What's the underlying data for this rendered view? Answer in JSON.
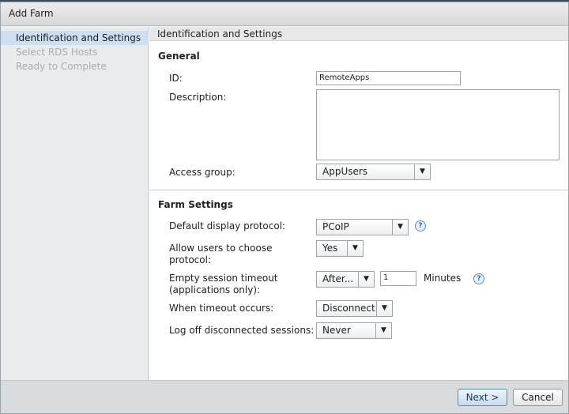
{
  "dialog": {
    "title": "Add Farm"
  },
  "sidebar": {
    "items": [
      {
        "label": "Identification and Settings",
        "state": "active"
      },
      {
        "label": "Select RDS Hosts",
        "state": "disabled"
      },
      {
        "label": "Ready to Complete",
        "state": "disabled"
      }
    ]
  },
  "content": {
    "header": "Identification and Settings",
    "general": {
      "title": "General",
      "id_label": "ID:",
      "id_value": "RemoteApps",
      "description_label": "Description:",
      "description_value": "",
      "access_group_label": "Access group:",
      "access_group_value": "AppUsers"
    },
    "farm_settings": {
      "title": "Farm Settings",
      "protocol_label": "Default display protocol:",
      "protocol_value": "PCoIP",
      "allow_choose_label_line1": "Allow users to choose",
      "allow_choose_label_line2": "protocol:",
      "allow_choose_value": "Yes",
      "timeout_label_line1": "Empty session timeout",
      "timeout_label_line2": "(applications only):",
      "timeout_mode_value": "After...",
      "timeout_amount": "1",
      "timeout_unit": "Minutes",
      "when_timeout_label": "When timeout occurs:",
      "when_timeout_value": "Disconnect",
      "logoff_label": "Log off disconnected sessions:",
      "logoff_value": "Never"
    },
    "help_glyph": "?"
  },
  "footer": {
    "next_label": "Next >",
    "cancel_label": "Cancel"
  },
  "colors": {
    "accent": "#cddff1",
    "next_button": "#c7dbef",
    "help": "#2e6fb0"
  },
  "icons": {
    "dropdown": "chevron-down-icon",
    "help": "help-icon"
  }
}
